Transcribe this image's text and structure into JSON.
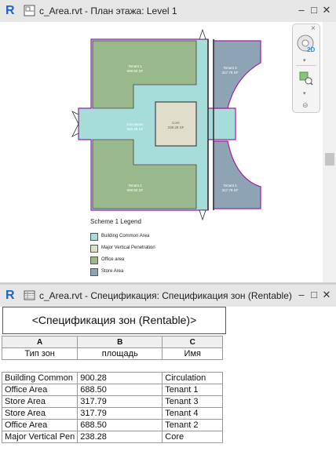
{
  "plan_window": {
    "app_logo": "R",
    "title": "c_Area.rvt - План этажа: Level 1",
    "minimize": "–",
    "maximize": "□",
    "close": "✕"
  },
  "navigation_bar": {
    "close": "×",
    "wheel_label": "2D"
  },
  "legend": {
    "title": "Scheme 1 Legend",
    "items": [
      {
        "label": "Building Common Area",
        "color": "#a6dcda"
      },
      {
        "label": "Major Vertical Penetration",
        "color": "#e0ddcb"
      },
      {
        "label": "Office area",
        "color": "#99b98d"
      },
      {
        "label": "Store Area",
        "color": "#8ea4b4"
      }
    ]
  },
  "schedule_window": {
    "app_logo": "R",
    "title": "c_Area.rvt - Спецификация: Спецификация зон (Rentable)",
    "minimize": "–",
    "maximize": "□",
    "close": "✕"
  },
  "schedule": {
    "title": "<Спецификация зон (Rentable)>",
    "column_letters": [
      "A",
      "B",
      "C"
    ],
    "column_labels": [
      "Тип зон",
      "площадь",
      "Имя"
    ],
    "rows": [
      [
        "Building Common",
        "900.28",
        "Circulation"
      ],
      [
        "Office Area",
        "688.50",
        "Tenant 1"
      ],
      [
        "Store Area",
        "317.79",
        "Tenant 3"
      ],
      [
        "Store Area",
        "317.79",
        "Tenant 4"
      ],
      [
        "Office Area",
        "688.50",
        "Tenant 2"
      ],
      [
        "Major Vertical Pen",
        "238.28",
        "Core"
      ]
    ]
  }
}
